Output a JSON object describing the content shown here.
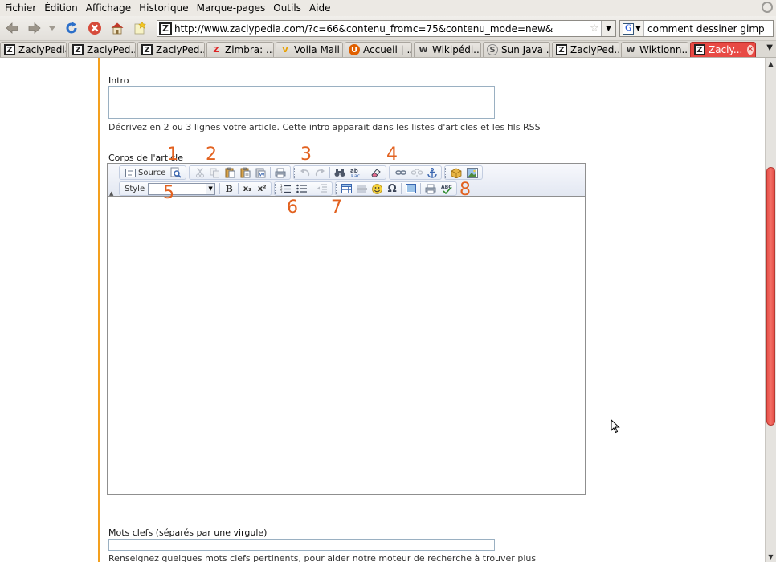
{
  "menu": [
    "Fichier",
    "Édition",
    "Affichage",
    "Historique",
    "Marque-pages",
    "Outils",
    "Aide"
  ],
  "navbar": {
    "url": "http://www.zaclypedia.com/?c=66&contenu_fromc=75&contenu_mode=new&",
    "url_favicon": "Z",
    "search_engine": "G",
    "search_query": "comment dessiner gimp"
  },
  "tabs": [
    {
      "icon": "Z",
      "label": "ZaclyPedia"
    },
    {
      "icon": "Z",
      "label": "ZaclyPed..."
    },
    {
      "icon": "Z",
      "label": "ZaclyPed..."
    },
    {
      "icon": "Z",
      "label": "Zimbra: ..."
    },
    {
      "icon": "V",
      "label": "Voila Mail"
    },
    {
      "icon": "U",
      "label": "Accueil | ..."
    },
    {
      "icon": "W",
      "label": "Wikipédi..."
    },
    {
      "icon": "S",
      "label": "Sun Java ..."
    },
    {
      "icon": "Z",
      "label": "ZaclyPed..."
    },
    {
      "icon": "W",
      "label": "Wiktionn..."
    },
    {
      "icon": "Z",
      "label": "Zacly..."
    }
  ],
  "form": {
    "intro_label": "Intro",
    "intro_help": "Décrivez en 2 ou 3 lignes votre article. Cette intro apparait dans les listes d'articles et les fils RSS",
    "body_label": "Corps de l'article",
    "keywords_label": "Mots clefs (séparés par une virgule)",
    "keywords_help": "Renseignez quelques mots clefs pertinents, pour aider notre moteur de recherche à trouver plus"
  },
  "toolbar": {
    "source_label": "Source",
    "style_label": "Style",
    "bold": "B",
    "subscript": "x₂",
    "superscript": "x²"
  },
  "annotations": [
    "1",
    "2",
    "3",
    "4",
    "5",
    "6",
    "7",
    "8"
  ],
  "colors": {
    "accent_orange": "#e2611f",
    "page_stripe": "#f4a01e",
    "active_tab": "#e84a44",
    "scroll_thumb": "#f36f66"
  }
}
